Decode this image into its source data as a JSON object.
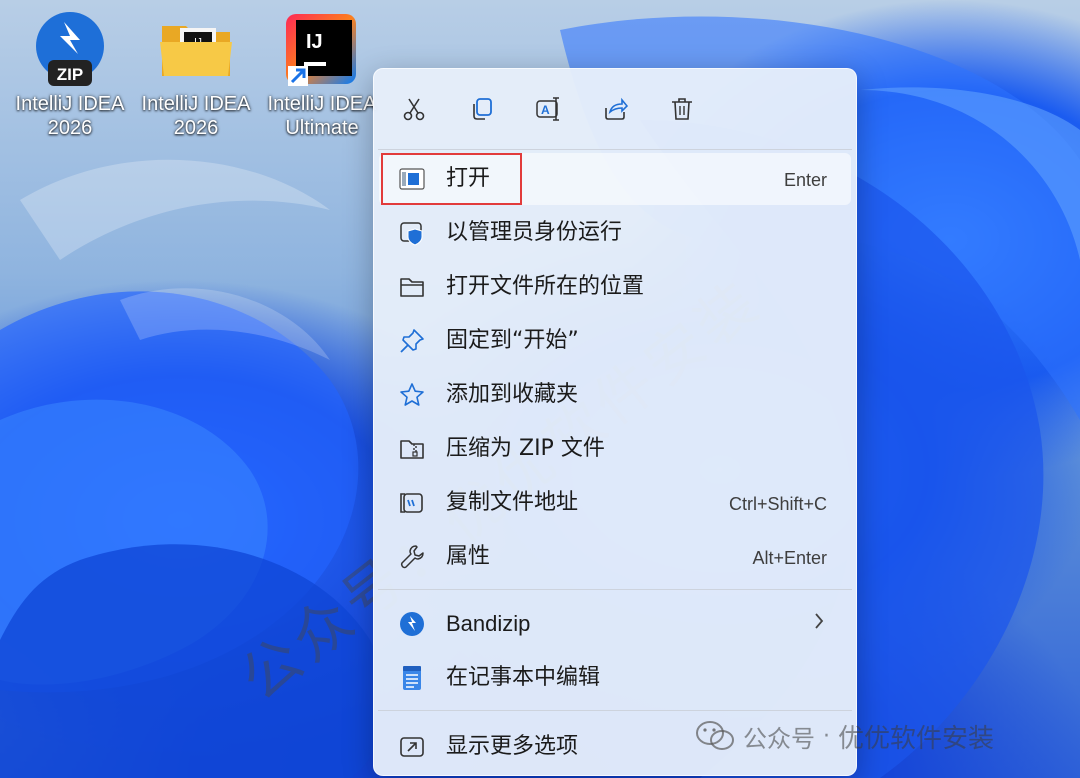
{
  "desktop": {
    "icons": [
      {
        "label_line1": "IntelliJ IDEA",
        "label_line2": "2026",
        "badge": "ZIP",
        "kind": "bandizip-archive-icon"
      },
      {
        "label_line1": "IntelliJ IDEA",
        "label_line2": "2026",
        "kind": "folder-icon"
      },
      {
        "label_line1": "IntelliJ IDEA",
        "label_line2": "Ultimate",
        "badge": "IJ",
        "kind": "intellij-shortcut-icon"
      }
    ]
  },
  "context_menu": {
    "toolbar": [
      {
        "icon": "cut-icon"
      },
      {
        "icon": "copy-icon"
      },
      {
        "icon": "rename-icon"
      },
      {
        "icon": "share-icon"
      },
      {
        "icon": "delete-icon"
      }
    ],
    "items": [
      {
        "label": "打开",
        "shortcut": "Enter",
        "icon": "open-app-icon"
      },
      {
        "label": "以管理员身份运行",
        "shortcut": "",
        "icon": "shield-admin-icon"
      },
      {
        "label": "打开文件所在的位置",
        "shortcut": "",
        "icon": "folder-icon"
      },
      {
        "label": "固定到“开始”",
        "shortcut": "",
        "icon": "pin-icon"
      },
      {
        "label": "添加到收藏夹",
        "shortcut": "",
        "icon": "star-icon"
      },
      {
        "label": "压缩为 ZIP 文件",
        "shortcut": "",
        "icon": "zip-folder-icon"
      },
      {
        "label": "复制文件地址",
        "shortcut": "Ctrl+Shift+C",
        "icon": "copy-path-icon"
      },
      {
        "label": "属性",
        "shortcut": "Alt+Enter",
        "icon": "wrench-icon"
      },
      {
        "label": "Bandizip",
        "shortcut": "",
        "icon": "bandizip-icon"
      },
      {
        "label": "在记事本中编辑",
        "shortcut": "",
        "icon": "notepad-icon"
      },
      {
        "label": "显示更多选项",
        "shortcut": "",
        "icon": "more-options-icon"
      }
    ]
  },
  "watermark": {
    "diagonal": "公众号：优优软件安装",
    "account_label": "公众号",
    "separator": "·",
    "account_name": "优优软件安装"
  },
  "colors": {
    "highlight_border": "#e23b3b",
    "menu_bg": "#e6eefa",
    "icon_blue": "#1f6fd6"
  }
}
